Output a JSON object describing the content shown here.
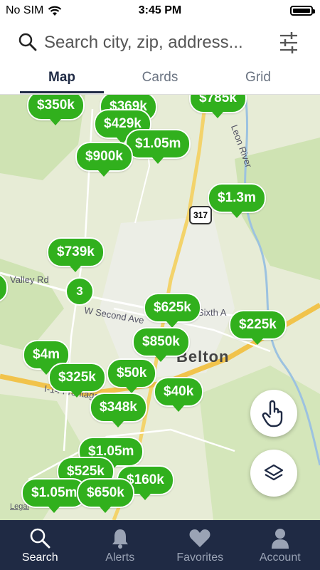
{
  "status": {
    "carrier": "No SIM",
    "time": "3:45 PM"
  },
  "search": {
    "placeholder": "Search city, zip, address..."
  },
  "tabs": [
    "Map",
    "Cards",
    "Grid"
  ],
  "map": {
    "city": "Belton",
    "route_shield": "317",
    "labels": {
      "valley": "Valley Rd",
      "second": "W Second Ave",
      "sixth": "Sixth A",
      "river": "Leon River",
      "i14": "I-14 Frontage",
      "legal": "Legal"
    },
    "pins": [
      "$350k",
      "$369k",
      "$785k",
      "$429k",
      "$1.05m",
      "$900k",
      "$1.3m",
      "$739k",
      "k",
      "$625k",
      "$225k",
      "$850k",
      "$4m",
      "$325k",
      "$50k",
      "$40k",
      "$348k",
      "$1.05m",
      "$525k",
      "$160k",
      "$1.05m",
      "$650k"
    ],
    "cluster": "3"
  },
  "bottom_nav": [
    {
      "label": "Search",
      "icon": "search-icon"
    },
    {
      "label": "Alerts",
      "icon": "bell-icon"
    },
    {
      "label": "Favorites",
      "icon": "heart-icon"
    },
    {
      "label": "Account",
      "icon": "person-icon"
    }
  ],
  "colors": {
    "pin": "#31b01d",
    "nav_bg": "#1f2a44",
    "accent": "#1f2a44"
  }
}
